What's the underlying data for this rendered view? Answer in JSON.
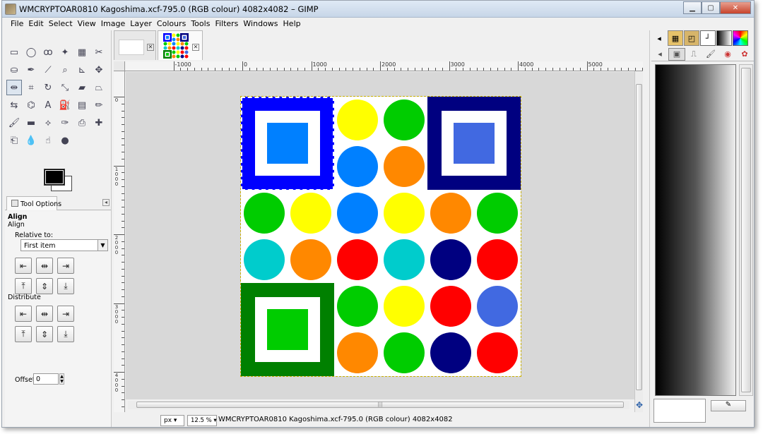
{
  "window": {
    "title": "WMCRYPTOAR0810 Kagoshima.xcf-795.0 (RGB colour) 4082x4082 – GIMP"
  },
  "menu": [
    {
      "label": "File"
    },
    {
      "label": "Edit"
    },
    {
      "label": "Select"
    },
    {
      "label": "View"
    },
    {
      "label": "Image"
    },
    {
      "label": "Layer"
    },
    {
      "label": "Colours"
    },
    {
      "label": "Tools"
    },
    {
      "label": "Filters"
    },
    {
      "label": "Windows"
    },
    {
      "label": "Help"
    }
  ],
  "toolbox": {
    "tools": [
      {
        "name": "rect-select-icon",
        "glyph": "▭"
      },
      {
        "name": "ellipse-select-icon",
        "glyph": "◯"
      },
      {
        "name": "free-select-icon",
        "glyph": "ꝏ"
      },
      {
        "name": "fuzzy-select-icon",
        "glyph": "✦"
      },
      {
        "name": "select-by-color-icon",
        "glyph": "▦"
      },
      {
        "name": "scissors-icon",
        "glyph": "✂"
      },
      {
        "name": "foreground-select-icon",
        "glyph": "⛀"
      },
      {
        "name": "paths-icon",
        "glyph": "✒"
      },
      {
        "name": "color-picker-icon",
        "glyph": "⟋"
      },
      {
        "name": "zoom-icon",
        "glyph": "⌕"
      },
      {
        "name": "measure-icon",
        "glyph": "⊾"
      },
      {
        "name": "move-icon",
        "glyph": "✥"
      },
      {
        "name": "align-icon",
        "glyph": "⇹"
      },
      {
        "name": "crop-icon",
        "glyph": "⌗"
      },
      {
        "name": "rotate-icon",
        "glyph": "↻"
      },
      {
        "name": "scale-icon",
        "glyph": "⤡"
      },
      {
        "name": "shear-icon",
        "glyph": "▰"
      },
      {
        "name": "perspective-icon",
        "glyph": "⏢"
      },
      {
        "name": "flip-icon",
        "glyph": "⇆"
      },
      {
        "name": "cage-icon",
        "glyph": "⌬"
      },
      {
        "name": "text-icon",
        "glyph": "A"
      },
      {
        "name": "bucket-fill-icon",
        "glyph": "⛽"
      },
      {
        "name": "blend-icon",
        "glyph": "▤"
      },
      {
        "name": "pencil-icon",
        "glyph": "✏"
      },
      {
        "name": "paintbrush-icon",
        "glyph": "🖌"
      },
      {
        "name": "eraser-icon",
        "glyph": "▬"
      },
      {
        "name": "airbrush-icon",
        "glyph": "⟡"
      },
      {
        "name": "ink-icon",
        "glyph": "✑"
      },
      {
        "name": "clone-icon",
        "glyph": "⎙"
      },
      {
        "name": "heal-icon",
        "glyph": "✚"
      },
      {
        "name": "perspective-clone-icon",
        "glyph": "⎗"
      },
      {
        "name": "blur-icon",
        "glyph": "💧"
      },
      {
        "name": "smudge-icon",
        "glyph": "☝"
      },
      {
        "name": "dodge-burn-icon",
        "glyph": "●"
      }
    ],
    "fg_color": "#000000",
    "bg_color": "#ffffff"
  },
  "tool_options": {
    "tab_label": "Tool Options",
    "heading": "Align",
    "subheading": "Align",
    "relative_label": "Relative to:",
    "relative_value": "First item",
    "distribute_label": "Distribute",
    "offset_label": "Offset:",
    "offset_value": "0"
  },
  "rulers": {
    "h_labels": [
      "-1000",
      "0",
      "1000",
      "2000",
      "3000",
      "4000",
      "5000"
    ],
    "v_labels": [
      "0",
      "1000",
      "2000",
      "3000",
      "4000"
    ]
  },
  "canvas": {
    "circle_colors": [
      "#ffff00",
      "#00cc00",
      "#0080ff",
      "#ff8800",
      "#00cc00",
      "#ffff00",
      "#0080ff",
      "#ffff00",
      "#ff8800",
      "#00cc00",
      "#00cccc",
      "#ff8800",
      "#ff0000",
      "#00cccc",
      "#000080",
      "#ff0000",
      "#00cc00",
      "#ffff00",
      "#ff0000",
      "#4169e1",
      "#ff8800",
      "#00cc00",
      "#000080",
      "#ff0000"
    ],
    "squares": [
      {
        "name": "blue-square",
        "outer": "#0000ff",
        "inner": "#0080ff"
      },
      {
        "name": "navy-square",
        "outer": "#000080",
        "inner": "#4169e1"
      },
      {
        "name": "green-square",
        "outer": "#008000",
        "inner": "#00cc00"
      }
    ]
  },
  "status": {
    "unit": "px",
    "zoom": "12.5 %",
    "text": "WMCRYPTOAR0810 Kagoshima.xcf-795.0 (RGB colour) 4082x4082"
  }
}
